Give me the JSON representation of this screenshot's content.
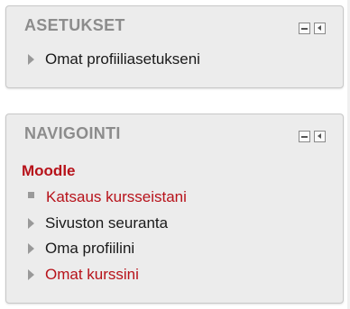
{
  "settings_block": {
    "title": "ASETUKSET",
    "items": [
      {
        "label": "Omat profiiliasetukseni"
      }
    ]
  },
  "nav_block": {
    "title": "NAVIGOINTI",
    "root": "Moodle",
    "items": [
      {
        "label": "Katsaus kursseistani",
        "icon": "square-bullet-icon",
        "link": true
      },
      {
        "label": "Sivuston seuranta",
        "icon": "expand-arrow-icon",
        "link": false
      },
      {
        "label": "Oma profiilini",
        "icon": "expand-arrow-icon",
        "link": false
      },
      {
        "label": "Omat kurssini",
        "icon": "expand-arrow-icon",
        "link": true
      }
    ]
  },
  "controls": {
    "hide_icon": "minimize-icon",
    "dock_icon": "dock-left-icon"
  },
  "colors": {
    "link": "#b7121a",
    "header": "#8c8c8c",
    "block_bg": "#ececec"
  }
}
